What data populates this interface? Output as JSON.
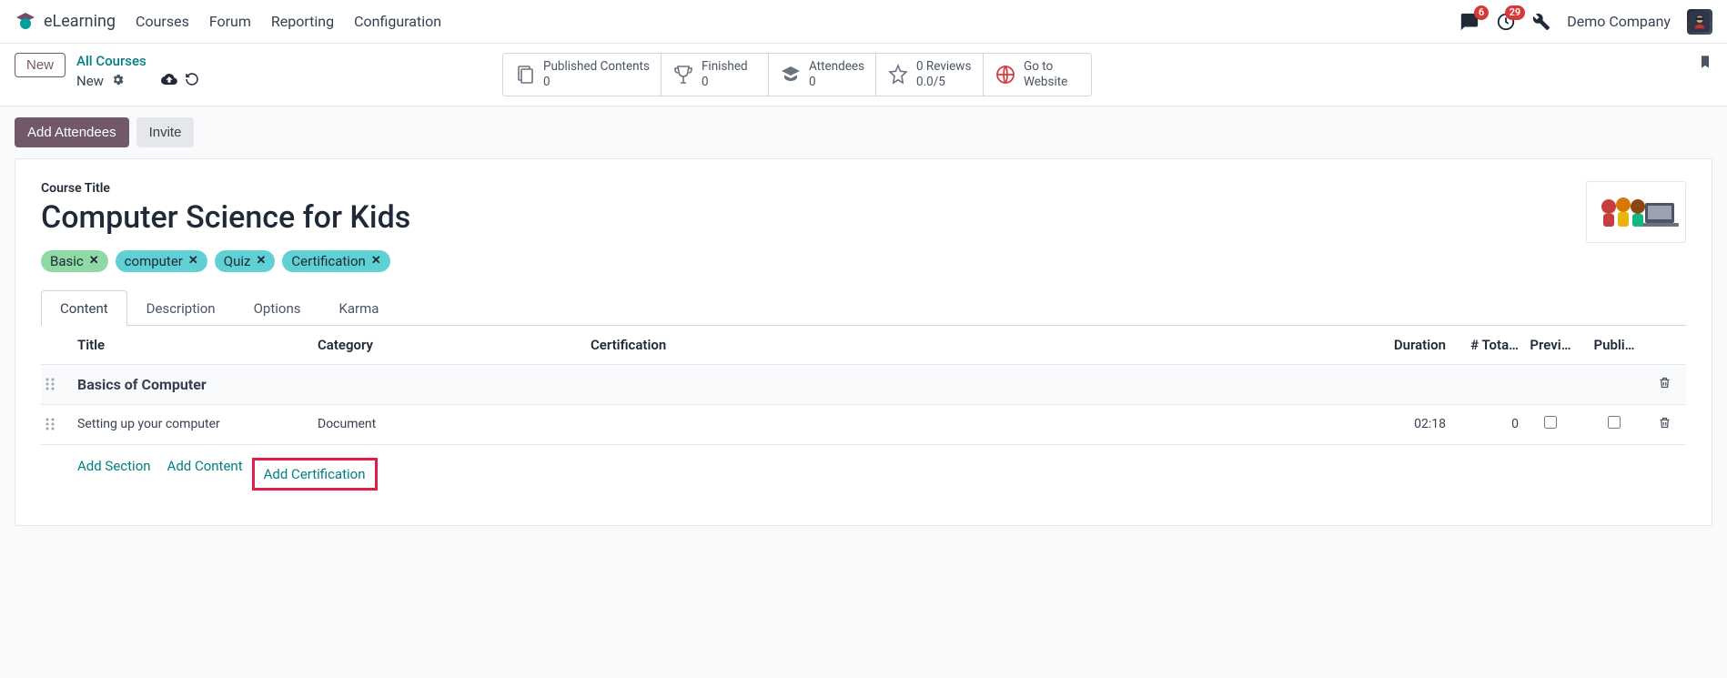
{
  "navbar": {
    "brand": "eLearning",
    "links": [
      "Courses",
      "Forum",
      "Reporting",
      "Configuration"
    ],
    "messaging_badge": "6",
    "activity_badge": "29",
    "company": "Demo Company"
  },
  "control": {
    "new_btn": "New",
    "breadcrumb_link": "All Courses",
    "breadcrumb_current": "New",
    "stats": {
      "published": {
        "label": "Published Contents",
        "value": "0"
      },
      "finished": {
        "label": "Finished",
        "value": "0"
      },
      "attendees": {
        "label": "Attendees",
        "value": "0"
      },
      "reviews": {
        "label": "0 Reviews",
        "value": "0.0/5"
      },
      "website": {
        "label": "Go to",
        "value": "Website"
      }
    }
  },
  "actions": {
    "add_attendees": "Add Attendees",
    "invite": "Invite"
  },
  "course": {
    "title_label": "Course Title",
    "title": "Computer Science for Kids",
    "tags": [
      "Basic",
      "computer",
      "Quiz",
      "Certification"
    ]
  },
  "tabs": [
    "Content",
    "Description",
    "Options",
    "Karma"
  ],
  "table": {
    "headers": {
      "title": "Title",
      "category": "Category",
      "cert": "Certification",
      "duration": "Duration",
      "tota": "# Tota…",
      "prev": "Previ…",
      "publ": "Publi…"
    },
    "section": {
      "title": "Basics of Computer"
    },
    "rows": [
      {
        "title": "Setting up your computer",
        "category": "Document",
        "duration": "02:18",
        "tota": "0"
      }
    ],
    "add": {
      "section": "Add Section",
      "content": "Add Content",
      "cert": "Add Certification"
    }
  }
}
